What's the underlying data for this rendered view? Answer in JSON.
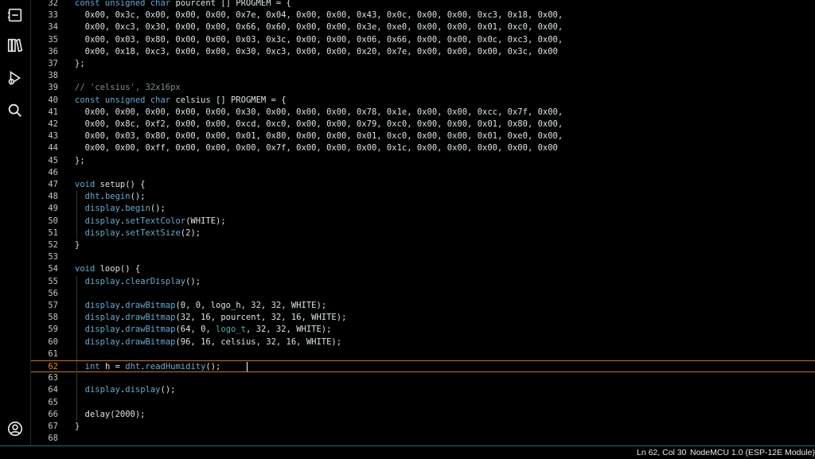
{
  "activity_bar": {
    "items": [
      {
        "name": "sketchbook-icon"
      },
      {
        "name": "library-icon"
      },
      {
        "name": "debug-icon"
      },
      {
        "name": "search-icon"
      },
      {
        "name": "account-icon"
      }
    ]
  },
  "editor": {
    "current_line": 62,
    "lines": [
      {
        "n": "32",
        "t": [
          [
            "kw",
            "const unsigned char "
          ],
          [
            "plain",
            "pourcent [] PROGMEM = {"
          ]
        ]
      },
      {
        "n": "33",
        "t": [
          [
            "plain",
            "  0x00, 0x3c, 0x00, 0x00, 0x00, 0x7e, 0x04, 0x00, 0x00, 0x43, 0x0c, 0x00, 0x00, 0xc3, 0x18, 0x00,"
          ]
        ]
      },
      {
        "n": "34",
        "t": [
          [
            "plain",
            "  0x00, 0xc3, 0x30, 0x00, 0x00, 0x66, 0x60, 0x00, 0x00, 0x3e, 0xe0, 0x00, 0x00, 0x01, 0xc0, 0x00,"
          ]
        ]
      },
      {
        "n": "35",
        "t": [
          [
            "plain",
            "  0x00, 0x03, 0x80, 0x00, 0x00, 0x03, 0x3c, 0x00, 0x00, 0x06, 0x66, 0x00, 0x00, 0x0c, 0xc3, 0x00,"
          ]
        ]
      },
      {
        "n": "36",
        "t": [
          [
            "plain",
            "  0x00, 0x18, 0xc3, 0x00, 0x00, 0x30, 0xc3, 0x00, 0x00, 0x20, 0x7e, 0x00, 0x00, 0x00, 0x3c, 0x00"
          ]
        ]
      },
      {
        "n": "37",
        "t": [
          [
            "plain",
            "};"
          ]
        ]
      },
      {
        "n": "38",
        "t": []
      },
      {
        "n": "39",
        "t": [
          [
            "cm",
            "// 'celsius', 32x16px"
          ]
        ]
      },
      {
        "n": "40",
        "t": [
          [
            "kw",
            "const unsigned char "
          ],
          [
            "plain",
            "celsius [] PROGMEM = {"
          ]
        ]
      },
      {
        "n": "41",
        "t": [
          [
            "plain",
            "  0x00, 0x00, 0x00, 0x00, 0x00, 0x30, 0x00, 0x00, 0x00, 0x78, 0x1e, 0x00, 0x00, 0xcc, 0x7f, 0x00,"
          ]
        ]
      },
      {
        "n": "42",
        "t": [
          [
            "plain",
            "  0x00, 0x8c, 0xf2, 0x00, 0x00, 0xcd, 0xc0, 0x00, 0x00, 0x79, 0xc0, 0x00, 0x00, 0x01, 0x80, 0x00,"
          ]
        ]
      },
      {
        "n": "43",
        "t": [
          [
            "plain",
            "  0x00, 0x03, 0x80, 0x00, 0x00, 0x01, 0x80, 0x00, 0x00, 0x01, 0xc0, 0x00, 0x00, 0x01, 0xe0, 0x00,"
          ]
        ]
      },
      {
        "n": "44",
        "t": [
          [
            "plain",
            "  0x00, 0x00, 0xff, 0x00, 0x00, 0x00, 0x7f, 0x00, 0x00, 0x00, 0x1c, 0x00, 0x00, 0x00, 0x00, 0x00"
          ]
        ]
      },
      {
        "n": "45",
        "t": [
          [
            "plain",
            "};"
          ]
        ]
      },
      {
        "n": "46",
        "t": []
      },
      {
        "n": "47",
        "t": [
          [
            "kw",
            "void "
          ],
          [
            "plain",
            "setup() {"
          ]
        ]
      },
      {
        "n": "48",
        "t": [
          [
            "plain",
            "  "
          ],
          [
            "fn",
            "dht"
          ],
          [
            "plain",
            "."
          ],
          [
            "fn",
            "begin"
          ],
          [
            "plain",
            "();"
          ]
        ]
      },
      {
        "n": "49",
        "t": [
          [
            "plain",
            "  "
          ],
          [
            "fn",
            "display"
          ],
          [
            "plain",
            "."
          ],
          [
            "fn",
            "begin"
          ],
          [
            "plain",
            "();"
          ]
        ]
      },
      {
        "n": "50",
        "t": [
          [
            "plain",
            "  "
          ],
          [
            "fn",
            "display"
          ],
          [
            "plain",
            "."
          ],
          [
            "fn",
            "setTextColor"
          ],
          [
            "plain",
            "(WHITE);"
          ]
        ]
      },
      {
        "n": "51",
        "t": [
          [
            "plain",
            "  "
          ],
          [
            "fn",
            "display"
          ],
          [
            "plain",
            "."
          ],
          [
            "fn",
            "setTextSize"
          ],
          [
            "plain",
            "(2);"
          ]
        ]
      },
      {
        "n": "52",
        "t": [
          [
            "plain",
            "}"
          ]
        ]
      },
      {
        "n": "53",
        "t": []
      },
      {
        "n": "54",
        "t": [
          [
            "kw",
            "void "
          ],
          [
            "plain",
            "loop() {"
          ]
        ]
      },
      {
        "n": "55",
        "t": [
          [
            "plain",
            "  "
          ],
          [
            "fn",
            "display"
          ],
          [
            "plain",
            "."
          ],
          [
            "fn",
            "clearDisplay"
          ],
          [
            "plain",
            "();"
          ]
        ]
      },
      {
        "n": "56",
        "t": []
      },
      {
        "n": "57",
        "t": [
          [
            "plain",
            "  "
          ],
          [
            "fn",
            "display"
          ],
          [
            "plain",
            "."
          ],
          [
            "fn",
            "drawBitmap"
          ],
          [
            "plain",
            "(0, 0, logo_h, 32, 32, WHITE);"
          ]
        ]
      },
      {
        "n": "58",
        "t": [
          [
            "plain",
            "  "
          ],
          [
            "fn",
            "display"
          ],
          [
            "plain",
            "."
          ],
          [
            "fn",
            "drawBitmap"
          ],
          [
            "plain",
            "(32, 16, pourcent, 32, 16, WHITE);"
          ]
        ]
      },
      {
        "n": "59",
        "t": [
          [
            "plain",
            "  "
          ],
          [
            "fn",
            "display"
          ],
          [
            "plain",
            "."
          ],
          [
            "fn",
            "drawBitmap"
          ],
          [
            "plain",
            "(64, 0, "
          ],
          [
            "teal",
            "logo_t"
          ],
          [
            "plain",
            ", 32, 32, WHITE);"
          ]
        ]
      },
      {
        "n": "60",
        "t": [
          [
            "plain",
            "  "
          ],
          [
            "fn",
            "display"
          ],
          [
            "plain",
            "."
          ],
          [
            "fn",
            "drawBitmap"
          ],
          [
            "plain",
            "(96, 16, celsius, 32, 16, WHITE);"
          ]
        ]
      },
      {
        "n": "61",
        "t": []
      },
      {
        "n": "62",
        "t": [
          [
            "plain",
            "  "
          ],
          [
            "kw",
            "int "
          ],
          [
            "plain",
            "h = "
          ],
          [
            "fn",
            "dht"
          ],
          [
            "plain",
            "."
          ],
          [
            "fn",
            "readHumidity"
          ],
          [
            "plain",
            "();"
          ]
        ]
      },
      {
        "n": "63",
        "t": []
      },
      {
        "n": "64",
        "t": [
          [
            "plain",
            "  "
          ],
          [
            "fn",
            "display"
          ],
          [
            "plain",
            "."
          ],
          [
            "fn",
            "display"
          ],
          [
            "plain",
            "();"
          ]
        ]
      },
      {
        "n": "65",
        "t": []
      },
      {
        "n": "66",
        "t": [
          [
            "plain",
            "  delay(2000);"
          ]
        ]
      },
      {
        "n": "67",
        "t": [
          [
            "plain",
            "}"
          ]
        ]
      },
      {
        "n": "68",
        "t": []
      }
    ]
  },
  "status": {
    "position": "Ln 62, Col 30",
    "board": "NodeMCU 1.0 (ESP-12E Module) on C"
  },
  "colors": {
    "keyword": "#6aa9cf",
    "comment": "#7f8c8d",
    "current_line_border": "#c86f2c",
    "status_border": "#1f6f7a"
  }
}
